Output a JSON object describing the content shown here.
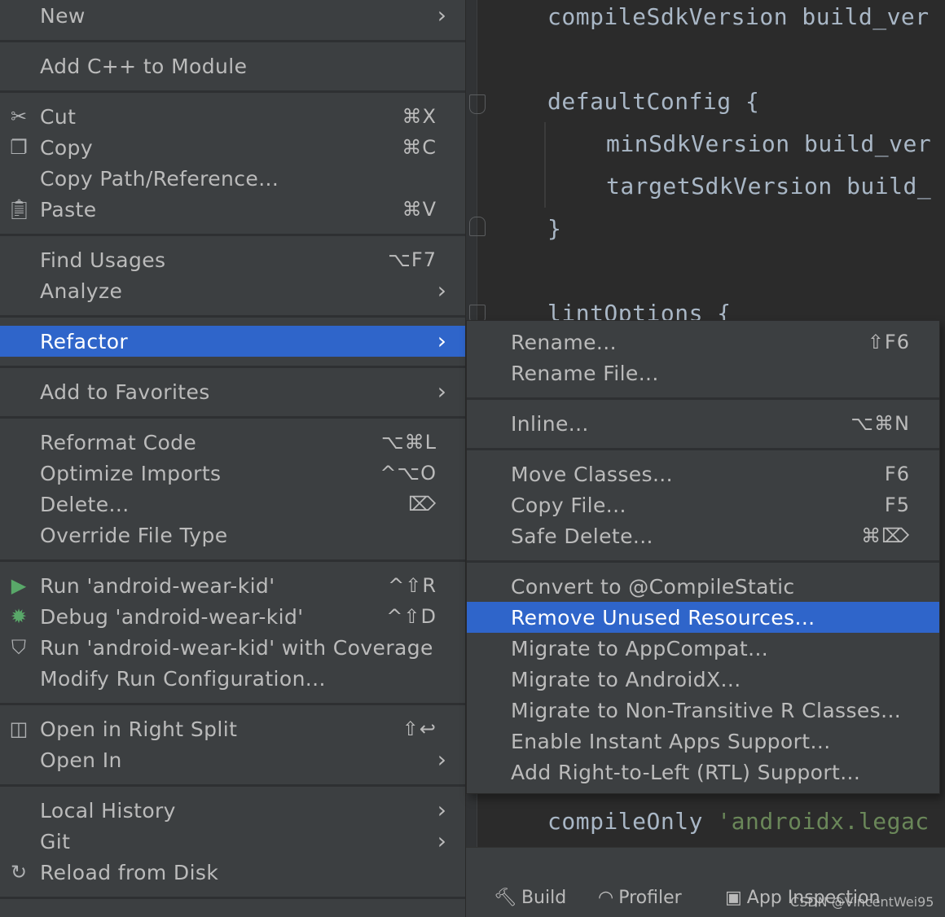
{
  "editor": {
    "lines": [
      {
        "text": "compileSdkVersion build_ver",
        "indent": 0
      },
      {
        "text": "defaultConfig {",
        "indent": 0
      },
      {
        "text": "minSdkVersion build_ver",
        "indent": 1
      },
      {
        "text": "targetSdkVersion build_",
        "indent": 1
      },
      {
        "text": "}",
        "indent": 0
      },
      {
        "text": "lintOptions {",
        "indent": 0
      }
    ],
    "bottom_line": {
      "code": "compileOnly ",
      "string": "'androidx.legac"
    }
  },
  "toolbar": {
    "build": "Build",
    "profiler": "Profiler",
    "app_inspection": "App Inspection"
  },
  "watermark": "CSDN @VincentWei95",
  "main_menu": {
    "new": {
      "label": "New"
    },
    "add_cpp": {
      "label": "Add C++ to Module"
    },
    "cut": {
      "label": "Cut",
      "shortcut": "⌘X"
    },
    "copy": {
      "label": "Copy",
      "shortcut": "⌘C"
    },
    "copy_path": {
      "label": "Copy Path/Reference..."
    },
    "paste": {
      "label": "Paste",
      "shortcut": "⌘V"
    },
    "find_usages": {
      "label": "Find Usages",
      "shortcut": "⌥F7"
    },
    "analyze": {
      "label": "Analyze"
    },
    "refactor": {
      "label": "Refactor"
    },
    "add_favorites": {
      "label": "Add to Favorites"
    },
    "reformat": {
      "label": "Reformat Code",
      "shortcut": "⌥⌘L"
    },
    "optimize_imports": {
      "label": "Optimize Imports",
      "shortcut": "^⌥O"
    },
    "delete": {
      "label": "Delete...",
      "shortcut": "⌦"
    },
    "override_type": {
      "label": "Override File Type"
    },
    "run": {
      "label": "Run 'android-wear-kid'",
      "shortcut": "^⇧R"
    },
    "debug": {
      "label": "Debug 'android-wear-kid'",
      "shortcut": "^⇧D"
    },
    "run_coverage": {
      "label": "Run 'android-wear-kid' with Coverage"
    },
    "modify_run": {
      "label": "Modify Run Configuration..."
    },
    "open_right_split": {
      "label": "Open in Right Split",
      "shortcut": "⇧↩"
    },
    "open_in": {
      "label": "Open In"
    },
    "local_history": {
      "label": "Local History"
    },
    "git": {
      "label": "Git"
    },
    "reload": {
      "label": "Reload from Disk"
    }
  },
  "sub_menu": {
    "rename": {
      "label": "Rename...",
      "shortcut": "⇧F6"
    },
    "rename_file": {
      "label": "Rename File..."
    },
    "inline": {
      "label": "Inline...",
      "shortcut": "⌥⌘N"
    },
    "move_classes": {
      "label": "Move Classes...",
      "shortcut": "F6"
    },
    "copy_file": {
      "label": "Copy File...",
      "shortcut": "F5"
    },
    "safe_delete": {
      "label": "Safe Delete...",
      "shortcut": "⌘⌦"
    },
    "convert_static": {
      "label": "Convert to @CompileStatic"
    },
    "remove_unused": {
      "label": "Remove Unused Resources..."
    },
    "migrate_appcompat": {
      "label": "Migrate to AppCompat..."
    },
    "migrate_androidx": {
      "label": "Migrate to AndroidX..."
    },
    "migrate_r": {
      "label": "Migrate to Non-Transitive R Classes..."
    },
    "instant_apps": {
      "label": "Enable Instant Apps Support..."
    },
    "rtl": {
      "label": "Add Right-to-Left (RTL) Support..."
    }
  }
}
